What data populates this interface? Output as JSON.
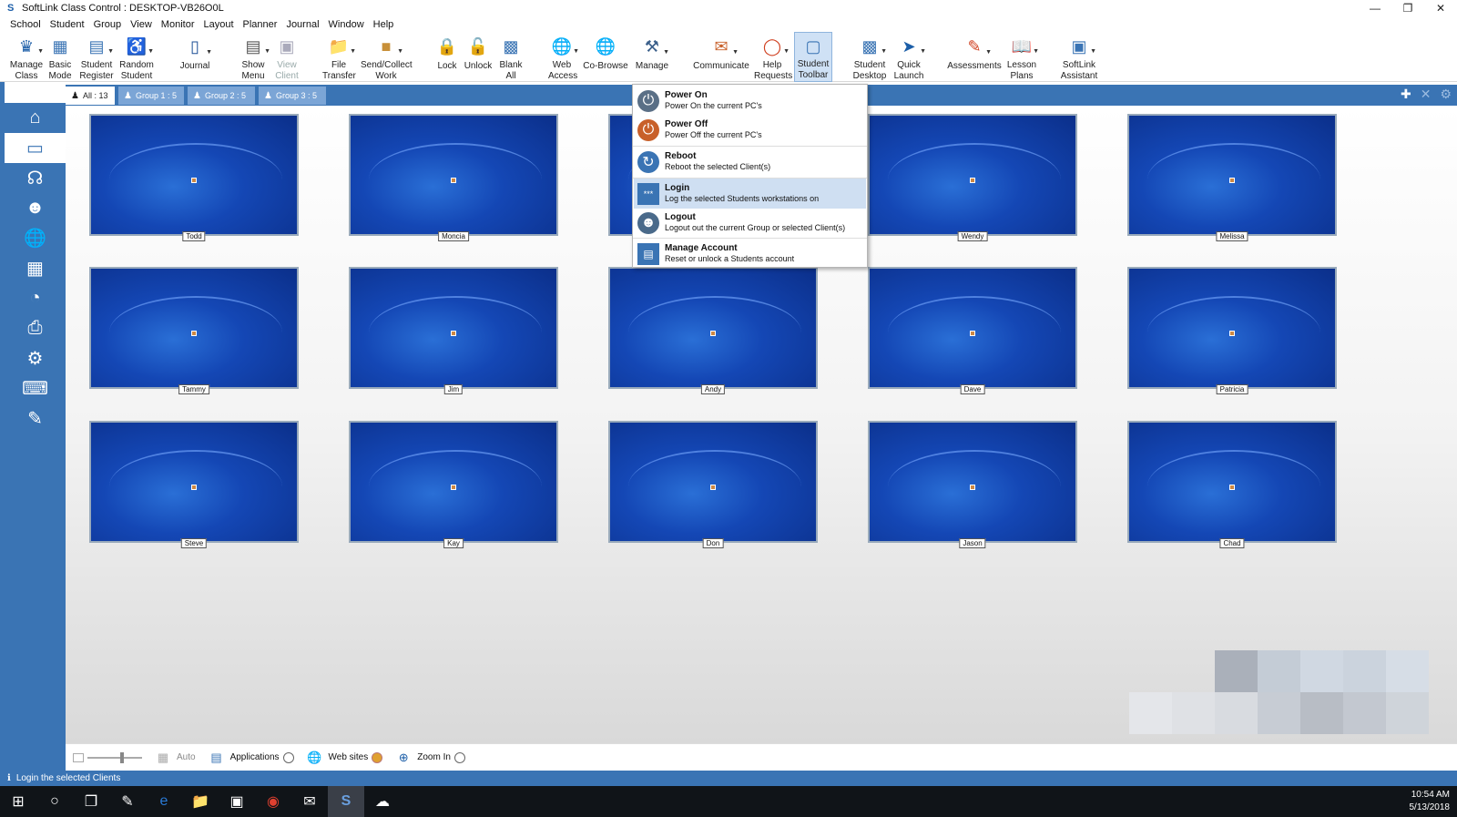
{
  "window": {
    "title": "SoftLink Class Control : DESKTOP-VB26O0L"
  },
  "menubar": [
    "School",
    "Student",
    "Group",
    "View",
    "Monitor",
    "Layout",
    "Planner",
    "Journal",
    "Window",
    "Help"
  ],
  "toolbar": {
    "manage_class": "Manage Class",
    "basic_mode": "Basic Mode",
    "student_register": "Student Register",
    "random_student": "Random Student",
    "journal": "Journal",
    "show_menu": "Show Menu",
    "view_client": "View Client",
    "file_transfer": "File Transfer",
    "send_collect": "Send/Collect Work",
    "lock": "Lock",
    "unlock": "Unlock",
    "blank_all": "Blank All",
    "web_access": "Web Access",
    "co_browse": "Co-Browse",
    "manage": "Manage",
    "communicate": "Communicate",
    "help_requests": "Help Requests",
    "student_toolbar": "Student Toolbar",
    "student_desktop": "Student Desktop",
    "quick_launch": "Quick Launch",
    "assessments": "Assessments",
    "lesson_plans": "Lesson Plans",
    "softlink_assistant": "SoftLink Assistant"
  },
  "tabs": [
    {
      "label": "All : 13"
    },
    {
      "label": "Group 1 : 5"
    },
    {
      "label": "Group 2 : 5"
    },
    {
      "label": "Group 3 : 5"
    }
  ],
  "students": [
    "Todd",
    "Moncia",
    "Wendy",
    "Melissa",
    "Tammy",
    "Jim",
    "Andy",
    "Dave",
    "Patricia",
    "Steve",
    "Kay",
    "Don",
    "Jason",
    "Chad"
  ],
  "manage_menu": [
    {
      "title": "Power On",
      "desc": "Power On the current PC's",
      "icon": "power-on-icon",
      "color": "#5a6f86"
    },
    {
      "title": "Power Off",
      "desc": "Power Off the current PC's",
      "icon": "power-off-icon",
      "color": "#c8602a"
    },
    {
      "title": "Reboot",
      "desc": "Reboot the selected Client(s)",
      "icon": "reboot-icon",
      "color": "#3a74b4"
    },
    {
      "title": "Login",
      "desc": "Log the selected Students workstations on",
      "icon": "login-icon",
      "color": "#3a74b4"
    },
    {
      "title": "Logout",
      "desc": "Logout out the current Group or selected Client(s)",
      "icon": "logout-icon",
      "color": "#4a6a8a"
    },
    {
      "title": "Manage Account",
      "desc": "Reset or unlock a Students account",
      "icon": "account-icon",
      "color": "#3a74b4"
    }
  ],
  "bottombar": {
    "auto": "Auto",
    "applications": "Applications",
    "websites": "Web sites",
    "zoom_in": "Zoom In"
  },
  "status": "Login the selected Clients",
  "clock": {
    "time": "10:54 AM",
    "date": "5/13/2018"
  },
  "colors": {
    "accent": "#3a74b4",
    "menu_highlight": "#cfdff2"
  }
}
